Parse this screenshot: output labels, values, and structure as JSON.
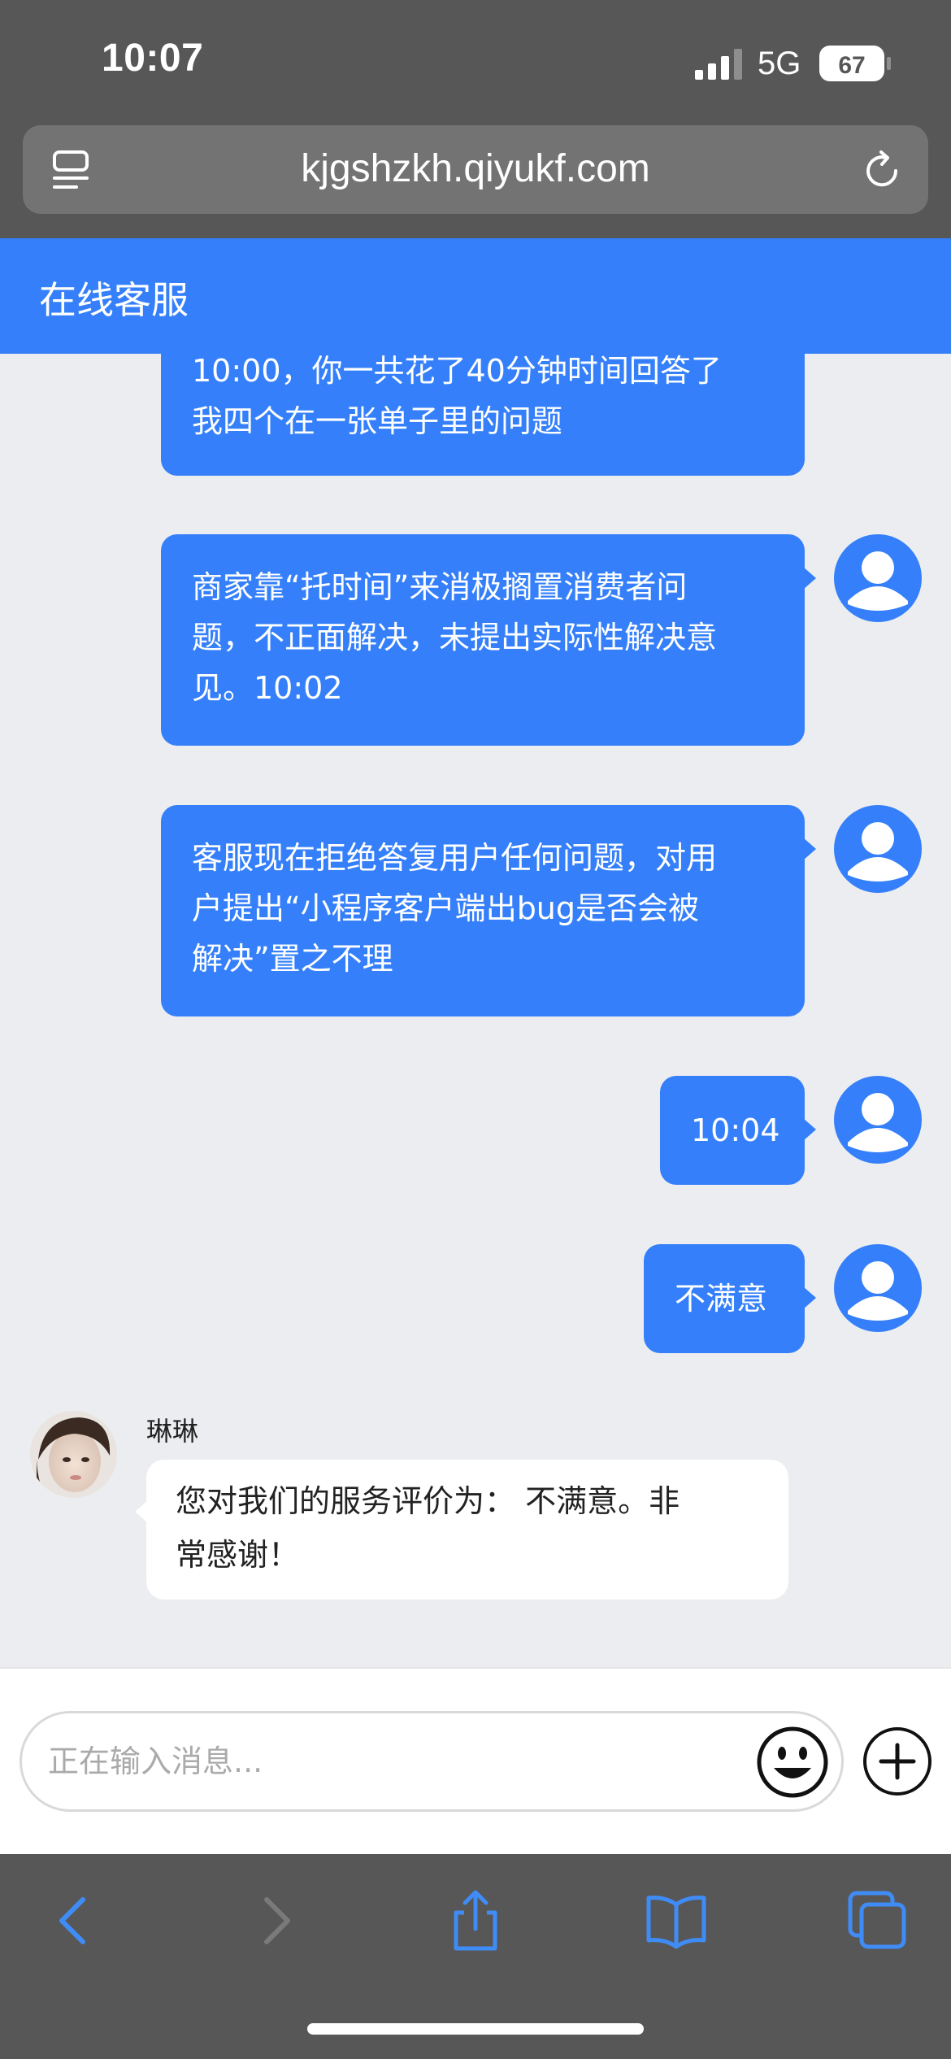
{
  "status": {
    "time": "10:07",
    "network": "5G",
    "battery": "67"
  },
  "browser": {
    "url": "kjgshzkh.qiyukf.com"
  },
  "header": {
    "title": "在线客服"
  },
  "messages": [
    {
      "line1": "10:00，你一共花了40分钟时间回答了",
      "line2": "我四个在一张单子里的问题"
    },
    {
      "line1": "商家靠“托时间”来消极搁置消费者问",
      "line2": "题，不正面解决，未提出实际性解决意",
      "line3": "见。10:02"
    },
    {
      "line1": "客服现在拒绝答复用户任何问题，对用",
      "line2": "户提出“小程序客户端出bug是否会被",
      "line3": "解决”置之不理"
    },
    {
      "text": "10:04"
    },
    {
      "text": "不满意"
    }
  ],
  "agent": {
    "name": "琳琳",
    "line1": "您对我们的服务评价为： 不满意。非",
    "line2": "常感谢！"
  },
  "input": {
    "placeholder": "正在输入消息..."
  },
  "colors": {
    "accent": "#3580fa",
    "chrome": "#575757",
    "chat_bg": "#ecedf0"
  },
  "icons": [
    "reader-icon",
    "reload-icon",
    "user-avatar-icon",
    "emoji-icon",
    "plus-icon",
    "back-icon",
    "forward-icon",
    "share-icon",
    "bookmarks-icon",
    "tabs-icon"
  ]
}
